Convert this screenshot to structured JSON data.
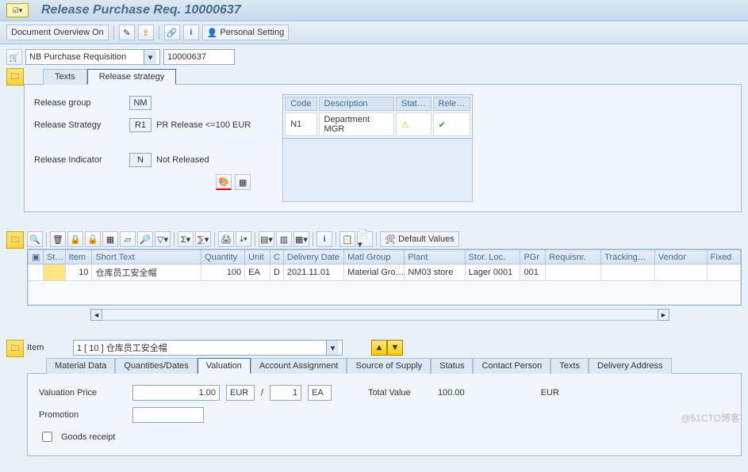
{
  "title": "Release Purchase Req. 10000637",
  "app_toolbar": {
    "doc_overview": "Document Overview On",
    "personal_setting": "Personal Setting"
  },
  "header": {
    "type_label": "NB Purchase Requisition",
    "number": "10000637"
  },
  "tabs_top": {
    "texts": "Texts",
    "release_strategy": "Release strategy"
  },
  "release": {
    "group_lbl": "Release group",
    "group_val": "NM",
    "strategy_lbl": "Release Strategy",
    "strategy_val": "R1",
    "strategy_txt": "PR Release <=100 EUR",
    "indicator_lbl": "Release Indicator",
    "indicator_val": "N",
    "indicator_txt": "Not Released",
    "table": {
      "hdr_code": "Code",
      "hdr_desc": "Description",
      "hdr_stat": "Stat…",
      "hdr_rele": "Rele…",
      "code": "N1",
      "desc": "Department MGR"
    }
  },
  "default_values_btn": "Default Values",
  "grid": {
    "hdr": {
      "st": "St…",
      "item": "Item",
      "short_text": "Short Text",
      "qty": "Quantity",
      "unit": "Unit",
      "c": "C",
      "del_date": "Delivery Date",
      "matl_grp": "Matl Group",
      "plant": "Plant",
      "stor": "Stor. Loc.",
      "pgr": "PGr",
      "requisnr": "Requisnr.",
      "tracking": "Tracking…",
      "vendor": "Vendor",
      "fixed": "Fixed"
    },
    "row": {
      "item": "10",
      "short_text": "仓库员工安全帽",
      "qty": "100",
      "unit": "EA",
      "c": "D",
      "del_date": "2021.11.01",
      "matl_grp": "Material Gro…",
      "plant": "NM03 store",
      "stor": "Lager 0001",
      "pgr": "001"
    }
  },
  "item_sel": {
    "lbl": "Item",
    "val": "1 [ 10 ] 仓库员工安全帽"
  },
  "item_tabs": {
    "material": "Material Data",
    "qty": "Quantities/Dates",
    "valuation": "Valuation",
    "acct": "Account Assignment",
    "source": "Source of Supply",
    "status": "Status",
    "contact": "Contact Person",
    "texts": "Texts",
    "delivery": "Delivery Address"
  },
  "valuation": {
    "price_lbl": "Valuation Price",
    "price_val": "1.00",
    "curr": "EUR",
    "per": "1",
    "unit": "EA",
    "total_lbl": "Total Value",
    "total_val": "100.00",
    "total_curr": "EUR",
    "promo_lbl": "Promotion",
    "goods_receipt": "Goods receipt"
  },
  "watermark": "@51CTO博客"
}
